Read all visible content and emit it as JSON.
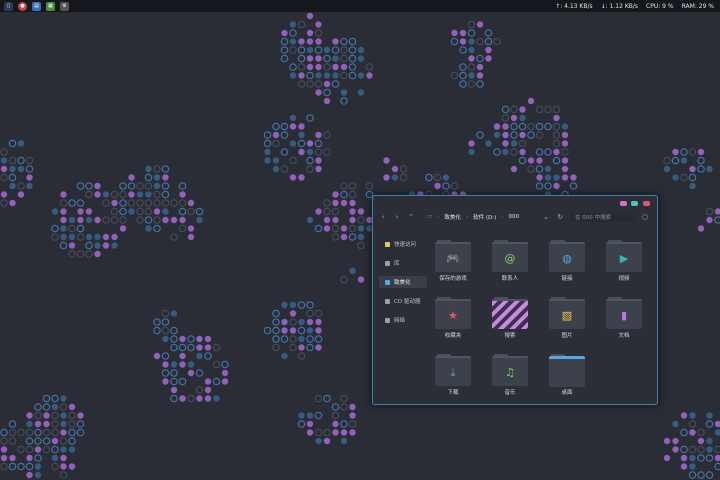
{
  "topbar": {
    "stats": [
      "↑: 4.13 KB/s",
      "↓: 1.12 KB/s",
      "CPU: 9 %",
      "RAM: 29 %"
    ]
  },
  "window": {
    "breadcrumb": [
      "致美化",
      "软件 (D:)",
      "000"
    ],
    "search_placeholder": "在 000 中搜索",
    "sidebar": [
      {
        "label": "快速访问",
        "icon": "star-icon",
        "color": "#f2c94c"
      },
      {
        "label": "库",
        "icon": "library-icon",
        "color": "#9aa0aa"
      },
      {
        "label": "致美化",
        "icon": "folder-icon",
        "color": "#5aa6e0"
      },
      {
        "label": "CD 驱动器",
        "icon": "disc-icon",
        "color": "#9aa0aa"
      },
      {
        "label": "网络",
        "icon": "network-icon",
        "color": "#9aa0aa"
      }
    ],
    "items": [
      {
        "label": "保存的游戏",
        "icon": "gamepad-icon",
        "glyph": "🎮",
        "color": "#5aa6e0"
      },
      {
        "label": "联系人",
        "icon": "at-icon",
        "glyph": "@",
        "color": "#8fd16a"
      },
      {
        "label": "链接",
        "icon": "globe-icon",
        "glyph": "◍",
        "color": "#5aa6e0"
      },
      {
        "label": "视频",
        "icon": "video-icon",
        "glyph": "▶",
        "color": "#3fb5b0"
      },
      {
        "label": "收藏夹",
        "icon": "star-icon",
        "glyph": "★",
        "color": "#e8566a"
      },
      {
        "label": "搜索",
        "icon": "search-folder-icon",
        "glyph": "",
        "color": "#c98ad8"
      },
      {
        "label": "图片",
        "icon": "picture-icon",
        "glyph": "▧",
        "color": "#f2c94c"
      },
      {
        "label": "文档",
        "icon": "document-icon",
        "glyph": "▮",
        "color": "#b07ce0"
      },
      {
        "label": "下载",
        "icon": "download-icon",
        "glyph": "⤓",
        "color": "#5aa6e0"
      },
      {
        "label": "音乐",
        "icon": "music-icon",
        "glyph": "♫",
        "color": "#8fd16a"
      },
      {
        "label": "桌面",
        "icon": "desktop-icon",
        "glyph": "",
        "color": "#5aa6e0"
      }
    ]
  }
}
